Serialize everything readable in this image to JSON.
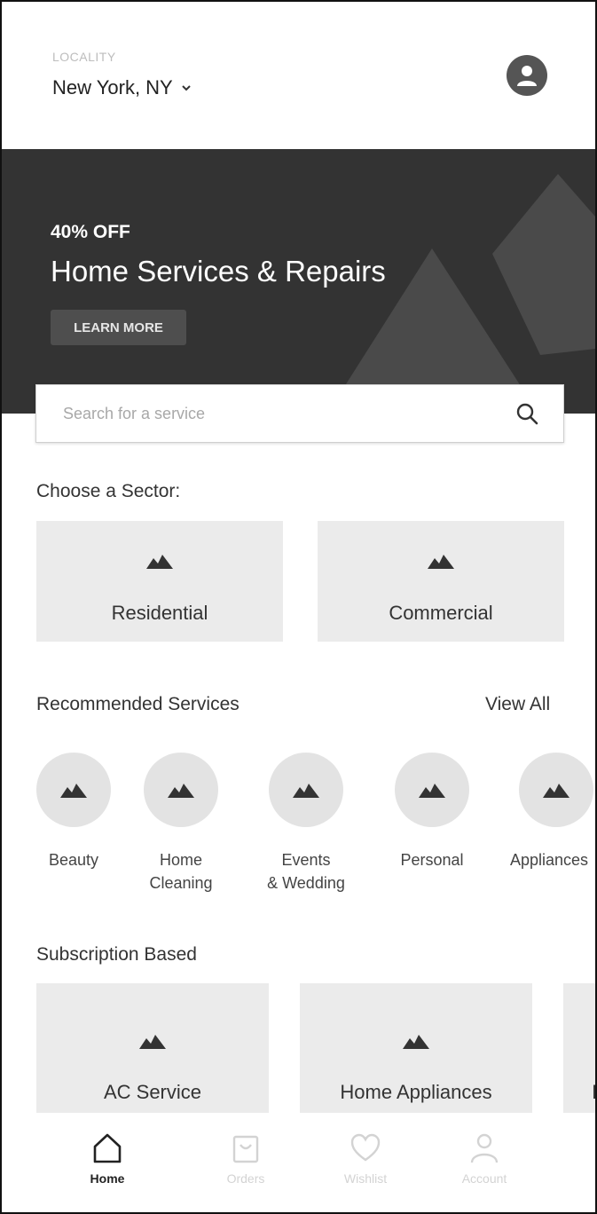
{
  "header": {
    "locality_caption": "LOCALITY",
    "locality_value": "New York, NY"
  },
  "banner": {
    "tag": "40% OFF",
    "title": "Home Services & Repairs",
    "button_label": "LEARN MORE"
  },
  "search": {
    "placeholder": "Search for a service"
  },
  "sectors": {
    "title": "Choose a Sector:",
    "items": [
      {
        "label": "Residential"
      },
      {
        "label": "Commercial"
      }
    ]
  },
  "recommended": {
    "title": "Recommended Services",
    "view_all": "View All",
    "items": [
      {
        "label": "Beauty"
      },
      {
        "label": "Home\nCleaning"
      },
      {
        "label": "Events\n& Wedding"
      },
      {
        "label": "Personal"
      },
      {
        "label": "Appliances"
      }
    ]
  },
  "subscription": {
    "title": "Subscription Based",
    "items": [
      {
        "label": "AC Service"
      },
      {
        "label": "Home Appliances"
      },
      {
        "label": "I"
      }
    ]
  },
  "nav": {
    "items": [
      {
        "label": "Home",
        "icon": "home-icon",
        "active": true
      },
      {
        "label": "Orders",
        "icon": "bag-icon",
        "active": false
      },
      {
        "label": "Wishlist",
        "icon": "heart-icon",
        "active": false
      },
      {
        "label": "Account",
        "icon": "person-icon",
        "active": false
      }
    ]
  },
  "colors": {
    "banner_bg": "#333333",
    "card_bg": "#ebebeb",
    "circle_bg": "#e3e3e3",
    "text_dark": "#333333",
    "nav_inactive": "#d3d3d3"
  }
}
